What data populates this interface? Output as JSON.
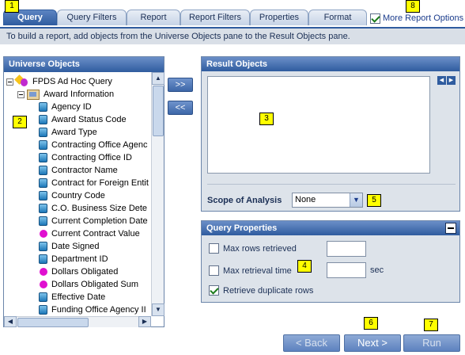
{
  "tabs": [
    {
      "label": "Query",
      "active": true
    },
    {
      "label": "Query Filters",
      "active": false
    },
    {
      "label": "Report",
      "active": false
    },
    {
      "label": "Report Filters",
      "active": false
    },
    {
      "label": "Properties",
      "active": false
    },
    {
      "label": "Format",
      "active": false
    }
  ],
  "more_options": {
    "label": "More Report Options",
    "checked": true
  },
  "instruction": "To build a report, add objects from the Universe Objects pane to the Result Objects pane.",
  "universe_panel": {
    "title": "Universe Objects",
    "root": "FPDS Ad Hoc Query",
    "class_folder": "Award Information",
    "objects": [
      {
        "label": "Agency ID",
        "kind": "dimension"
      },
      {
        "label": "Award Status Code",
        "kind": "dimension"
      },
      {
        "label": "Award Type",
        "kind": "dimension"
      },
      {
        "label": "Contracting Office Agenc",
        "kind": "dimension"
      },
      {
        "label": "Contracting Office ID",
        "kind": "dimension"
      },
      {
        "label": "Contractor Name",
        "kind": "dimension"
      },
      {
        "label": "Contract for Foreign Entit",
        "kind": "dimension"
      },
      {
        "label": "Country Code",
        "kind": "dimension"
      },
      {
        "label": "C.O. Business Size Dete",
        "kind": "dimension"
      },
      {
        "label": "Current Completion Date",
        "kind": "dimension"
      },
      {
        "label": "Current Contract Value",
        "kind": "measure"
      },
      {
        "label": "Date Signed",
        "kind": "dimension"
      },
      {
        "label": "Department ID",
        "kind": "dimension"
      },
      {
        "label": "Dollars Obligated",
        "kind": "measure"
      },
      {
        "label": "Dollars Obligated Sum",
        "kind": "measure"
      },
      {
        "label": "Effective Date",
        "kind": "dimension"
      },
      {
        "label": "Funding Office Agency II",
        "kind": "dimension"
      }
    ]
  },
  "move_buttons": {
    "add": ">>",
    "remove": "<<"
  },
  "result_panel": {
    "title": "Result Objects",
    "scope_label": "Scope of Analysis",
    "scope_value": "None"
  },
  "query_properties": {
    "title": "Query Properties",
    "max_rows": {
      "label": "Max rows retrieved",
      "checked": false,
      "value": ""
    },
    "max_time": {
      "label": "Max retrieval time",
      "checked": false,
      "value": "",
      "unit": "sec"
    },
    "retrieve_duplicates": {
      "label": "Retrieve duplicate rows",
      "checked": true
    }
  },
  "wizard_buttons": {
    "back": "< Back",
    "next": "Next >",
    "run": "Run"
  },
  "callouts": [
    "1",
    "2",
    "3",
    "4",
    "5",
    "6",
    "7",
    "8"
  ],
  "colors": {
    "accent": "#2f5c9f",
    "callout": "#ffff00"
  }
}
